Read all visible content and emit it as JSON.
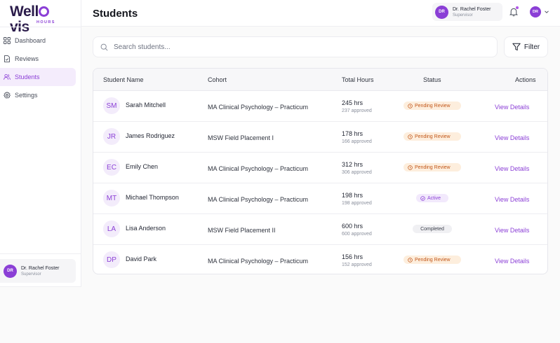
{
  "brand": {
    "logo_pre": "Well",
    "logo_post": "vis",
    "logo_sub": "HOURS",
    "accent": "#8b3fd6"
  },
  "sidebar": {
    "items": [
      {
        "label": "Dashboard",
        "icon": "dashboard-grid-icon",
        "active": false
      },
      {
        "label": "Reviews",
        "icon": "document-check-icon",
        "active": false
      },
      {
        "label": "Students",
        "icon": "users-icon",
        "active": true
      },
      {
        "label": "Settings",
        "icon": "gear-icon",
        "active": false
      }
    ],
    "user": {
      "initials": "DR",
      "name": "Dr. Rachel Foster",
      "role": "Supervisor"
    }
  },
  "header": {
    "title": "Students",
    "user": {
      "initials": "DR",
      "name": "Dr. Rachel Foster",
      "role": "Supervisor"
    },
    "avatar_initials": "DR"
  },
  "search": {
    "placeholder": "Search students..."
  },
  "filter": {
    "label": "Filter"
  },
  "table": {
    "columns": [
      "Student Name",
      "Cohort",
      "Total Hours",
      "Status",
      "Actions"
    ],
    "rows": [
      {
        "initials": "SM",
        "name": "Sarah Mitchell",
        "cohort": "MA Clinical Psychology – Practicum",
        "hours": "245 hrs",
        "approved": "237 approved",
        "status": "Pending Review",
        "status_type": "pending",
        "action": "View Details"
      },
      {
        "initials": "JR",
        "name": "James Rodriguez",
        "cohort": "MSW Field Placement I",
        "hours": "178 hrs",
        "approved": "166 approved",
        "status": "Pending Review",
        "status_type": "pending",
        "action": "View Details"
      },
      {
        "initials": "EC",
        "name": "Emily Chen",
        "cohort": "MA Clinical Psychology – Practicum",
        "hours": "312 hrs",
        "approved": "306 approved",
        "status": "Pending Review",
        "status_type": "pending",
        "action": "View Details"
      },
      {
        "initials": "MT",
        "name": "Michael Thompson",
        "cohort": "MA Clinical Psychology – Practicum",
        "hours": "198 hrs",
        "approved": "198 approved",
        "status": "Active",
        "status_type": "active",
        "action": "View Details"
      },
      {
        "initials": "LA",
        "name": "Lisa Anderson",
        "cohort": "MSW Field Placement II",
        "hours": "600 hrs",
        "approved": "600 approved",
        "status": "Completed",
        "status_type": "completed",
        "action": "View Details"
      },
      {
        "initials": "DP",
        "name": "David Park",
        "cohort": "MA Clinical Psychology – Practicum",
        "hours": "156 hrs",
        "approved": "152 approved",
        "status": "Pending Review",
        "status_type": "pending",
        "action": "View Details"
      }
    ]
  }
}
